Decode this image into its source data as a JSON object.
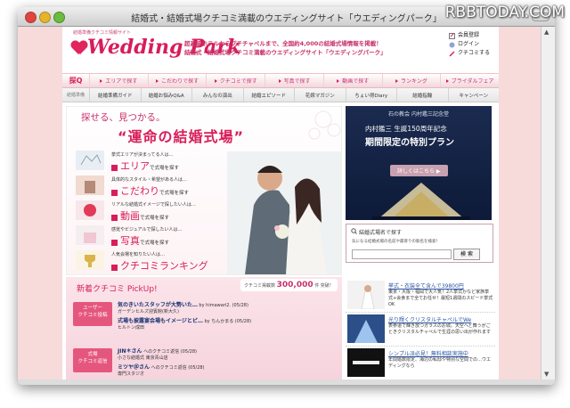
{
  "watermark": "RBBTODAY.COM",
  "window": {
    "title": "結婚式・結婚式場クチコミ満載のウエディングサイト「ウエディングパーク」"
  },
  "header": {
    "small_caption": "結婚準備クチコミ情報サイト",
    "logo": "Wedding Park",
    "tagline1": "超高級ホテルからプチチャペルまで、全国約4,000の結婚式場情報を掲載！",
    "tagline2": "結婚式・結婚式場クチコミ満載のウエディングサイト「ウエディングパーク」",
    "links": [
      "会員登録",
      "ログイン",
      "クチコミする"
    ]
  },
  "nav1": {
    "search_label": "探Q",
    "items": [
      "エリアで探す",
      "こだわりで探す",
      "クチコミで探す",
      "写真で探す",
      "動画で探す",
      "ランキング",
      "ブライダルフェア"
    ]
  },
  "nav2": {
    "guide_label": "結婚準備",
    "items": [
      "結婚準備ガイド",
      "結婚お悩みQ&A",
      "みんなの演出",
      "結婚エピソード",
      "花嫁マガジン",
      "ちょい得Diary",
      "結婚指輪",
      "キャンペーン"
    ]
  },
  "promo": {
    "title1": "探せる、見つかる。",
    "title2": "運命の結婚式場",
    "rows": [
      {
        "small": "挙式エリアが決まってる人は…",
        "big": "エリア",
        "rest": "で式場を探す"
      },
      {
        "small": "具体的なスタイル・希望がある人は…",
        "big": "こだわり",
        "rest": "で式場を探す"
      },
      {
        "small": "リアルな結婚式イメージで探したい人は…",
        "big": "動画",
        "rest": "で式場を探す"
      },
      {
        "small": "感覚やビジュアルで探したい人は…",
        "big": "写真",
        "rest": "で式場を探す"
      },
      {
        "small": "人気会場を知りたい人は…",
        "big": "クチコミランキング",
        "rest": ""
      }
    ]
  },
  "ad": {
    "head": "石の教会 内村鑑三記念堂",
    "line1": "内村鑑三 生誕150周年記念",
    "line2": "期間限定の特別プラン",
    "button": "詳しくはこちら ▶"
  },
  "venue_search": {
    "title": "結婚式場名で探す",
    "desc": "気になる結婚式場の名前や最寄りの駅名を検索！",
    "button": "検 索"
  },
  "kuchikomi": {
    "heading": "新着クチコミ PickUp!",
    "count_prefix": "クチコミ掲載数",
    "count": "300,000",
    "count_suffix": "件 突破！",
    "tag1": "ユーザー\nクチコミ投稿",
    "tag2": "式場\nクチコミ返信",
    "posts": [
      {
        "title": "気のきいたスタッフが大勢いた…",
        "meta": "by himawari2. (05/28)",
        "place": "ガーデンヒルズ迎賓館(新大久)"
      },
      {
        "title": "式場も披露宴会場もイメージとピ…",
        "meta": "by ちんかまる (05/28)",
        "place": "ヒルトン成田"
      }
    ],
    "replies": [
      {
        "title": "JIN＊さん",
        "meta": "へのクチコミ返信 (05/28)",
        "place": "小さな結婚式 東京青山店"
      },
      {
        "title": "ミツヤ＠さん",
        "meta": "へのクチコミ返信 (05/28)",
        "place": "専門スタジオ"
      }
    ]
  },
  "side_ads": [
    {
      "title": "挙式・衣装全て含んで39800円",
      "body": "東京・大阪・福岡で大人気！2人挙式かなど家族挙式+会食まで全てお任せ！最短1週間のスピード挙式OK"
    },
    {
      "title": "光り輝くクリスタルチャペルでWe",
      "body": "表参道で輝き放つガラスのお城。天空へと舞うがごときクリスタルチャペルで生涯の思い出が作れます"
    },
    {
      "title": "シンプル派必見！無料相談実施中",
      "body": "年間婚数限定、海辺の私邸や特別な空間での…ウエディングなら"
    }
  ],
  "colors": {
    "brand": "#d81d5a",
    "page_bg": "#f7dada"
  }
}
